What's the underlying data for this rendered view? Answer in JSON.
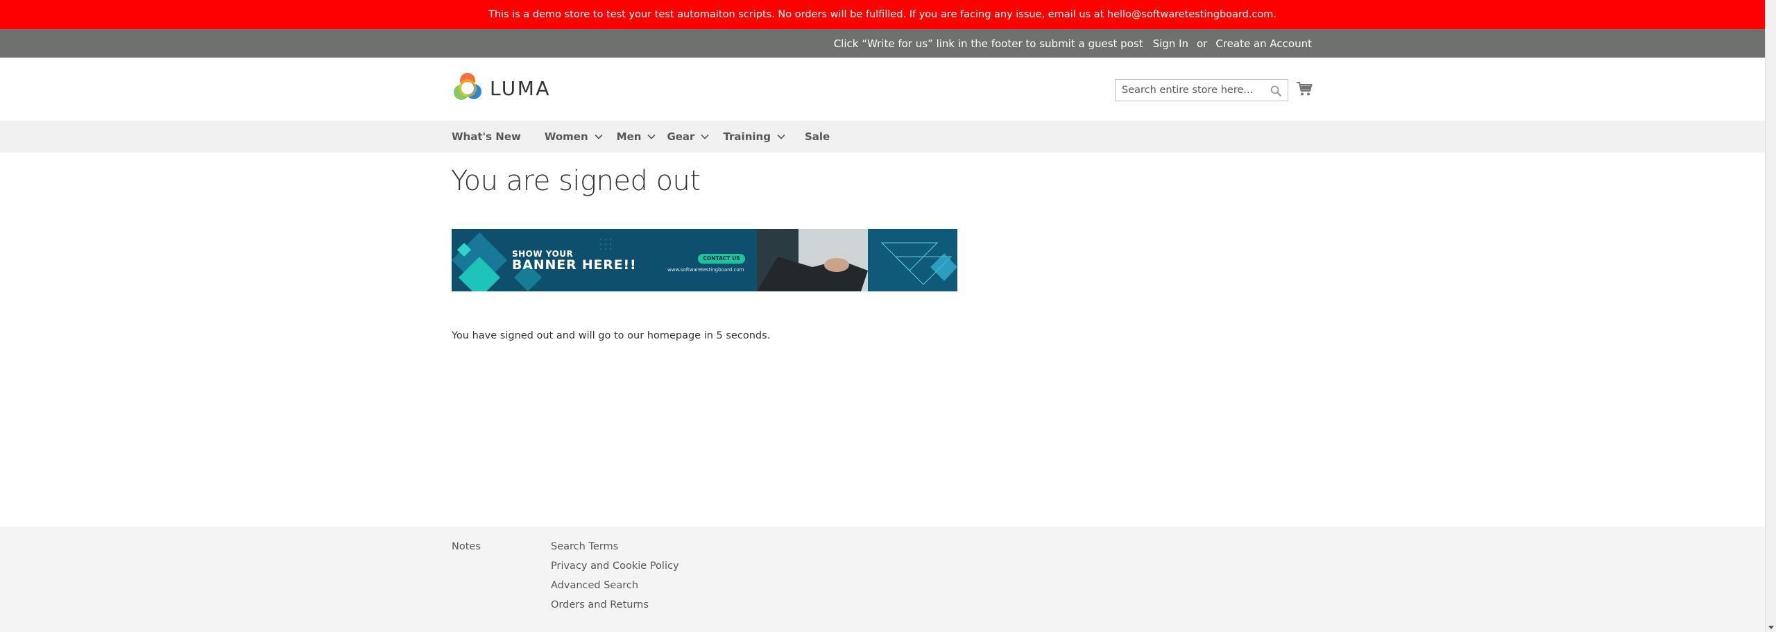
{
  "demo_notice": "This is a demo store to test your test automaiton scripts. No orders will be fulfilled. If you are facing any issue, email us at hello@softwaretestingboard.com.",
  "panel": {
    "promo": "Click “Write for us” link in the footer to submit a guest post",
    "sign_in": "Sign In",
    "or": "or",
    "create_account": "Create an Account"
  },
  "header": {
    "logo_text": "LUMA",
    "search_placeholder": "Search entire store here..."
  },
  "nav": {
    "items": [
      {
        "label": "What's New",
        "has_submenu": false
      },
      {
        "label": "Women",
        "has_submenu": true
      },
      {
        "label": "Men",
        "has_submenu": true
      },
      {
        "label": "Gear",
        "has_submenu": true
      },
      {
        "label": "Training",
        "has_submenu": true
      },
      {
        "label": "Sale",
        "has_submenu": false
      }
    ]
  },
  "main": {
    "title": "You are signed out",
    "banner": {
      "line1": "SHOW YOUR",
      "line2": "BANNER HERE!!",
      "button": "CONTACT US",
      "url": "www.softwaretestingboard.com"
    },
    "message": "You have signed out and will go to our homepage in 5 seconds."
  },
  "footer": {
    "col1": [
      "Notes"
    ],
    "col2": [
      "Search Terms",
      "Privacy and Cookie Policy",
      "Advanced Search",
      "Orders and Returns"
    ]
  },
  "colors": {
    "notice_bg": "#ff0000",
    "panel_bg": "#6e716e",
    "nav_bg": "#f0f0f0",
    "footer_bg": "#f4f4f4"
  }
}
